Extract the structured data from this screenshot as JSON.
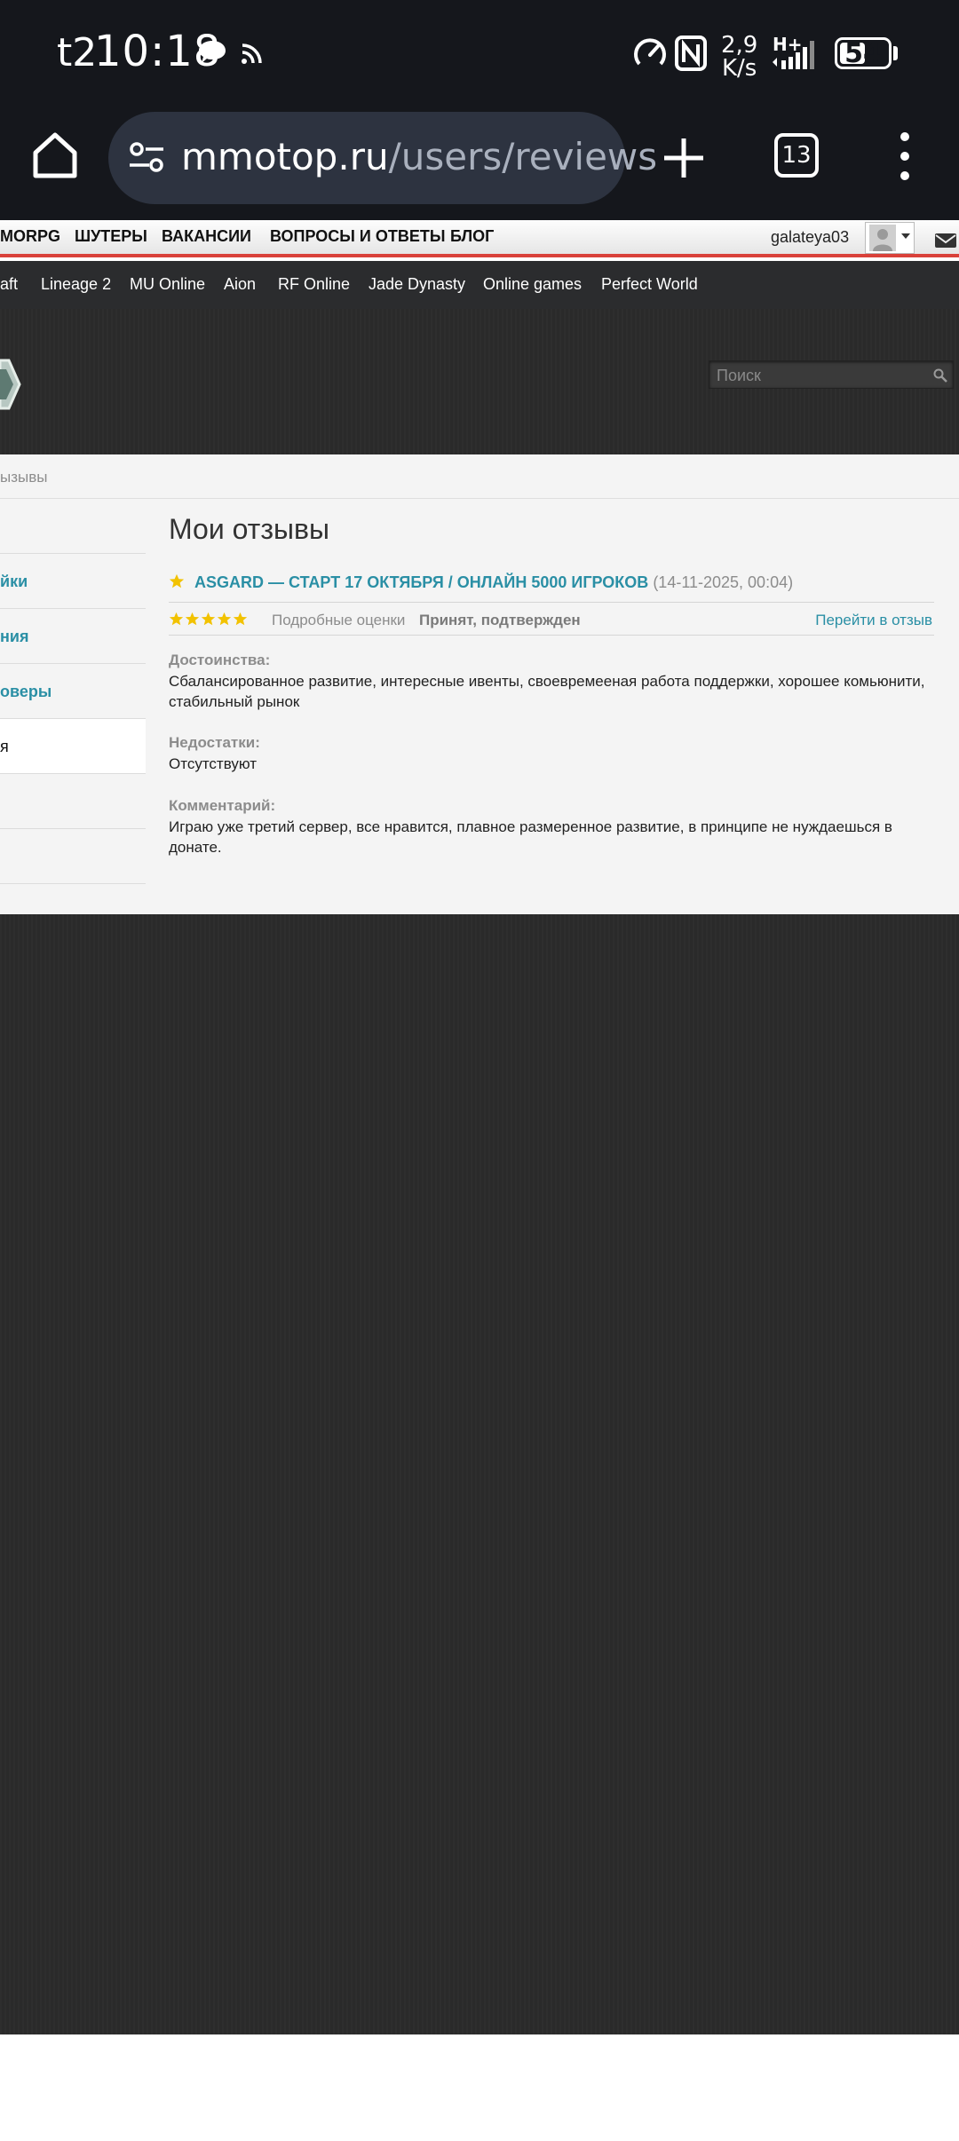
{
  "status_bar": {
    "carrier": "t2",
    "time": "10:18",
    "net_rate_value": "2,9",
    "net_rate_unit": "K/s",
    "network_type": "H+",
    "battery": "54",
    "battery_level_percent": 54
  },
  "browser": {
    "url_host": "mmotop.ru",
    "url_path": "/users/reviews",
    "tab_count": "13"
  },
  "site_nav": {
    "items": [
      "MORPG",
      "ШУТЕРЫ",
      "ВАКАНСИИ",
      "ВОПРОСЫ И ОТВЕТЫ",
      "БЛОГ"
    ],
    "username": "galateya03"
  },
  "game_nav": {
    "items": [
      "aft",
      "Lineage 2",
      "MU Online",
      "Aion",
      "RF Online",
      "Jade Dynasty",
      "Online games",
      "Perfect World"
    ]
  },
  "search": {
    "placeholder": "Поиск"
  },
  "breadcrumb": "ызывы",
  "sidebar": {
    "items": [
      {
        "label": ""
      },
      {
        "label": "йки"
      },
      {
        "label": "ния"
      },
      {
        "label": "оверы"
      },
      {
        "label": "я"
      },
      {
        "label": ""
      },
      {
        "label": ""
      }
    ]
  },
  "main": {
    "page_title": "Мои отзывы",
    "review": {
      "server_title": "ASGARD — СТАРТ 17 ОКТЯБРЯ / ОНЛАЙН 5000 ИГРОКОВ",
      "date": "(14-11-2025, 00:04)",
      "rating_stars": 5,
      "detailed_ratings_label": "Подробные оценки",
      "status": "Принят, подтвержден",
      "goto_label": "Перейти в отзыв",
      "pros_label": "Достоинства:",
      "pros_text": "Сбалансированное развитие, интересные ивенты, своевремееная работа поддержки, хорошее комьюнити, стабильный рынок",
      "cons_label": "Недостатки:",
      "cons_text": "Отсутствуют",
      "comment_label": "Комментарий:",
      "comment_text": "Играю уже третий сервер, все нравится, плавное размеренное развитие, в принципе не нуждаешься в донате."
    }
  },
  "colors": {
    "link": "#2a8fa5",
    "star": "#f2c200",
    "nav_accent": "#d9413a",
    "status_bar_bg": "#15171c",
    "url_pill_bg": "#2d3340"
  }
}
